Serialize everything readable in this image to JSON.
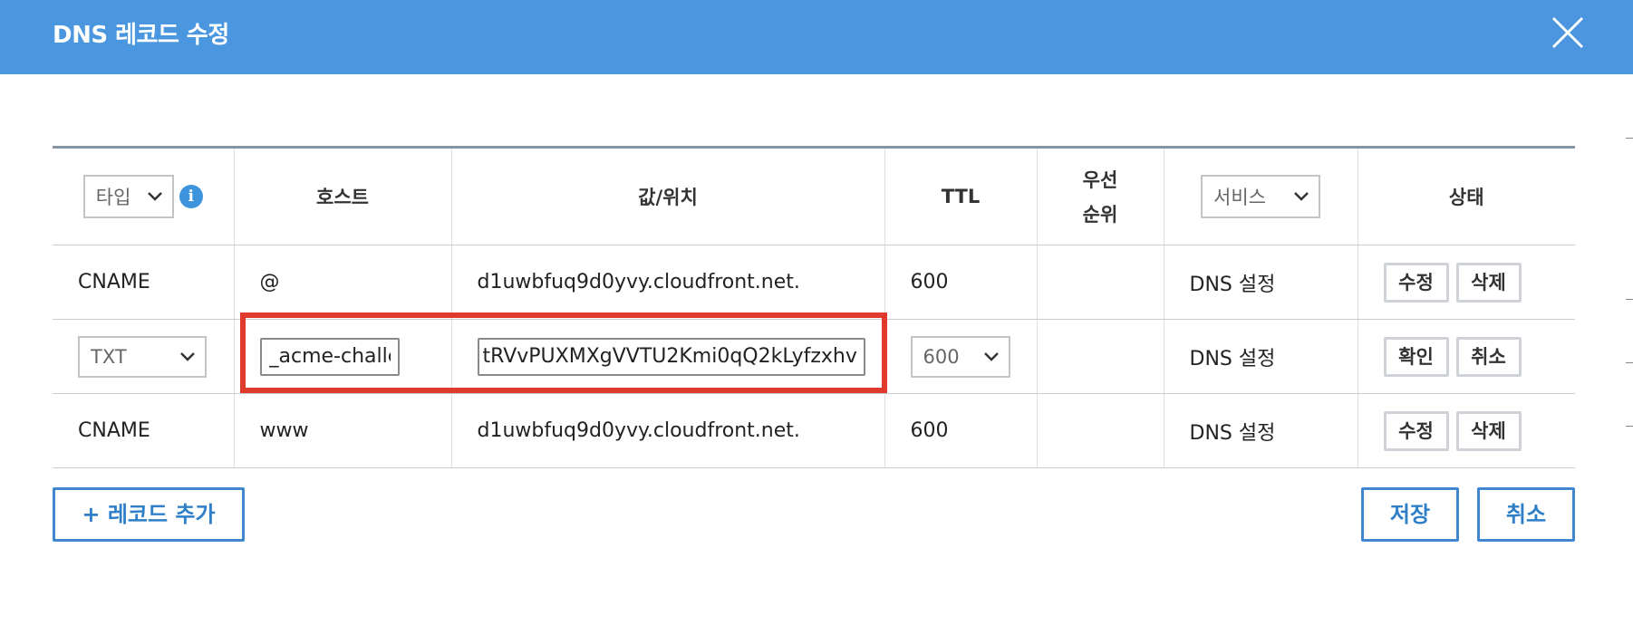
{
  "dialog": {
    "title": "DNS 레코드 수정"
  },
  "table": {
    "headers": {
      "type_select": "타입",
      "host": "호스트",
      "value": "값/위치",
      "ttl": "TTL",
      "priority_line1": "우선",
      "priority_line2": "순위",
      "service_select": "서비스",
      "status": "상태"
    },
    "rows": [
      {
        "type": "CNAME",
        "host": "@",
        "value": "d1uwbfuq9d0yvy.cloudfront.net.",
        "ttl": "600",
        "priority": "",
        "service": "DNS 설정",
        "edit_label": "수정",
        "delete_label": "삭제"
      },
      {
        "type": "TXT",
        "host": "_acme-challenge",
        "value": "tRVvPUXMXgVVTU2Kmi0qQ2kLyfzxhv",
        "ttl": "600",
        "priority": "",
        "service": "DNS 설정",
        "confirm_label": "확인",
        "cancel_label": "취소"
      },
      {
        "type": "CNAME",
        "host": "www",
        "value": "d1uwbfuq9d0yvy.cloudfront.net.",
        "ttl": "600",
        "priority": "",
        "service": "DNS 설정",
        "edit_label": "수정",
        "delete_label": "삭제"
      }
    ]
  },
  "footer": {
    "add_record_label": "+ 레코드 추가",
    "save_label": "저장",
    "cancel_label": "취소"
  },
  "colors": {
    "header_bg": "#4a97e0",
    "button_border": "#3f87cf",
    "highlight": "#e03a2e"
  },
  "icons": [
    "close-icon",
    "info-icon",
    "chevron-down-icon"
  ]
}
